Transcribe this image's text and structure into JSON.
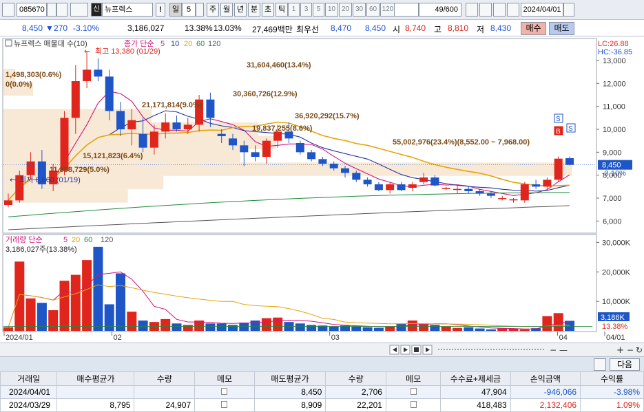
{
  "toolbar": {
    "code": "085670",
    "name": "뉴프렉스",
    "name_badge": "신",
    "alert": "!",
    "period_selected": "일",
    "period_value": "5",
    "periods": [
      "주",
      "월",
      "년",
      "분",
      "초",
      "틱"
    ],
    "timeframes": [
      "1",
      "3",
      "5",
      "10",
      "20",
      "30",
      "60",
      "120"
    ],
    "count": "49",
    "count_total": "/600",
    "date": "2024/04/01"
  },
  "quote": {
    "price": "8,450",
    "change": "270",
    "change_pct": "-3.10%",
    "volume": "3,186,027",
    "turnover_pct": "13.38%",
    "pct2": "13.03%",
    "amount": "27,469백만",
    "best_label": "최우선",
    "best_sell": "8,470",
    "best_buy": "8,450",
    "open_label": "시",
    "open": "8,740",
    "high_label": "고",
    "high": "8,810",
    "low_label": "저",
    "low": "8,430",
    "buy_button": "매수",
    "sell_button": "매도"
  },
  "chart": {
    "legend_price_title": "뉴프렉스 매물대 수(10)",
    "legend_ma_title": "종가 단순",
    "legend_ma_periods": [
      "5",
      "10",
      "20",
      "60",
      "120"
    ],
    "ma_colors": [
      "#d3137e",
      "#2635a0",
      "#e6a50a",
      "#1f8a3a",
      "#555555"
    ],
    "lc_label": "LC:26.88",
    "hc_label": "HC:-36.85",
    "high_marker": "최고 13,380 (01/29)",
    "low_marker": "최저 6,660 (01/19)",
    "volume_profile_labels": [
      "1,498,303(0.6%)",
      "0(0.0%)",
      "31,604,460(13.4%)",
      "30,360,726(12.9%)",
      "21,171,814(9.0%)",
      "36,920,292(15.7%)",
      "19,837,255(8.6%)",
      "55,002,976(23.4%)(8,552.00 ~ 7,968.00)",
      "15,121,823(6.4%)",
      "11,858,729(5.0%)"
    ],
    "price_axis": [
      "13,000",
      "12,000",
      "11,000",
      "10,000",
      "9,000",
      "8,000",
      "7,000",
      "6,000"
    ],
    "current_price_tag": "8,450",
    "current_change_tag": "-3.10%",
    "signal_marker": "S",
    "buy_marker": "B",
    "volume_legend_title": "거래량 단순",
    "volume_legend_periods": [
      "5",
      "20",
      "60",
      "120"
    ],
    "volume_summary": "3,186,027주(13.38%)",
    "volume_axis": [
      "30,000K",
      "20,000K",
      "10,000K"
    ],
    "volume_tag": "3,186K",
    "volume_pct_tag": "13.38%",
    "date_axis": [
      "2024/01",
      "02",
      "03",
      "04",
      "04/01"
    ]
  },
  "chart_data": {
    "type": "candlestick",
    "title": "뉴프렉스 매물대 수(10)",
    "y_range": [
      5500,
      13900
    ],
    "x": [
      "01/02",
      "01/03",
      "01/04",
      "01/05",
      "01/08",
      "01/09",
      "01/10",
      "01/11",
      "01/12",
      "01/15",
      "01/16",
      "01/17",
      "01/18",
      "01/19",
      "01/22",
      "01/23",
      "01/24",
      "01/25",
      "01/26",
      "01/29",
      "01/30",
      "01/31",
      "02/01",
      "02/02",
      "02/05",
      "02/06",
      "02/07",
      "02/08",
      "02/13",
      "02/14",
      "02/15",
      "02/16",
      "02/19",
      "02/20",
      "02/21",
      "02/22",
      "02/23",
      "02/26",
      "02/27",
      "02/28",
      "02/29",
      "03/04",
      "03/05",
      "03/06",
      "03/07",
      "03/08",
      "03/11",
      "03/12",
      "04/01"
    ],
    "series": [
      {
        "name": "OHLC",
        "ohlc": [
          [
            6700,
            7200,
            6600,
            6900
          ],
          [
            6900,
            8200,
            6800,
            8000
          ],
          [
            8000,
            9000,
            7800,
            8600
          ],
          [
            8600,
            9100,
            7400,
            7600
          ],
          [
            7600,
            8500,
            7300,
            8200
          ],
          [
            8200,
            10800,
            8000,
            10500
          ],
          [
            10500,
            12800,
            9800,
            12100
          ],
          [
            12100,
            13380,
            11800,
            12600
          ],
          [
            12600,
            13100,
            12100,
            12300
          ],
          [
            12300,
            12600,
            10400,
            10800
          ],
          [
            10800,
            11200,
            9700,
            10000
          ],
          [
            10000,
            10900,
            9300,
            10400
          ],
          [
            9800,
            10500,
            9000,
            9200
          ],
          [
            9200,
            10200,
            8900,
            9900
          ],
          [
            9900,
            10700,
            9600,
            10300
          ],
          [
            10300,
            10600,
            9900,
            10000
          ],
          [
            10000,
            10500,
            9800,
            10200
          ],
          [
            10200,
            11500,
            9900,
            11300
          ],
          [
            11300,
            11600,
            10100,
            10500
          ],
          [
            9800,
            10000,
            9400,
            9700
          ],
          [
            9600,
            9800,
            9100,
            9300
          ],
          [
            9300,
            9500,
            8400,
            9000
          ],
          [
            9000,
            9300,
            8600,
            8800
          ],
          [
            8800,
            9600,
            8500,
            9500
          ],
          [
            9500,
            10200,
            9200,
            9900
          ],
          [
            9900,
            10300,
            9400,
            9600
          ],
          [
            9400,
            9500,
            8900,
            9000
          ],
          [
            9000,
            9100,
            8600,
            8700
          ],
          [
            8700,
            8800,
            8400,
            8500
          ],
          [
            8500,
            8600,
            8200,
            8300
          ],
          [
            8300,
            8400,
            7900,
            8100
          ],
          [
            8100,
            8200,
            7700,
            7800
          ],
          [
            7800,
            7900,
            7500,
            7600
          ],
          [
            7600,
            7700,
            7300,
            7350
          ],
          [
            7350,
            7700,
            7200,
            7600
          ],
          [
            7600,
            7700,
            7300,
            7350
          ],
          [
            7450,
            7700,
            7300,
            7600
          ],
          [
            7700,
            8100,
            7600,
            7900
          ],
          [
            7900,
            8000,
            7500,
            7550
          ],
          [
            7400,
            7500,
            7350,
            7450
          ],
          [
            7400,
            7600,
            7200,
            7400
          ],
          [
            7400,
            7500,
            7200,
            7300
          ],
          [
            7300,
            7400,
            7100,
            7200
          ],
          [
            7200,
            7300,
            7000,
            7100
          ],
          [
            7000,
            7100,
            6900,
            7000
          ],
          [
            6900,
            7000,
            6800,
            6950
          ],
          [
            6900,
            7700,
            6800,
            7600
          ],
          [
            7600,
            7800,
            7400,
            7500
          ],
          [
            7500,
            7900,
            7400,
            7800
          ],
          [
            7800,
            8810,
            7700,
            8720
          ],
          [
            8740,
            8810,
            8430,
            8450
          ]
        ]
      }
    ],
    "volume": [
      {
        "name": "거래량",
        "unit": "K",
        "values": [
          1200,
          23500,
          11000,
          9500,
          7000,
          17000,
          19000,
          24000,
          28500,
          9000,
          19500,
          6500,
          3500,
          3000,
          4000,
          2500,
          2000,
          3500,
          2500,
          2500,
          2000,
          2800,
          3500,
          4300,
          4500,
          3000,
          2500,
          2000,
          1800,
          1500,
          1800,
          1500,
          1200,
          1000,
          1500,
          2500,
          3500,
          2500,
          2000,
          1500,
          1000,
          1200,
          800,
          500,
          800,
          700,
          500,
          900,
          5000,
          6000,
          3400,
          23400,
          3200
        ]
      }
    ]
  },
  "bottom": {
    "next_button": "다음",
    "table_headers": [
      "거래일",
      "매수평균가",
      "수량",
      "메모",
      "매도평균가",
      "수량",
      "메모",
      "수수료+제세금",
      "손익금액",
      "수익률"
    ],
    "rows": [
      [
        "2024/04/01",
        "",
        "",
        "",
        "8,450",
        "2,706",
        "",
        "47,904",
        "-946,066",
        "-3.98%"
      ],
      [
        "2024/03/29",
        "8,795",
        "24,907",
        "",
        "8,909",
        "22,201",
        "",
        "418,483",
        "2,132,406",
        "1.09%"
      ]
    ]
  }
}
